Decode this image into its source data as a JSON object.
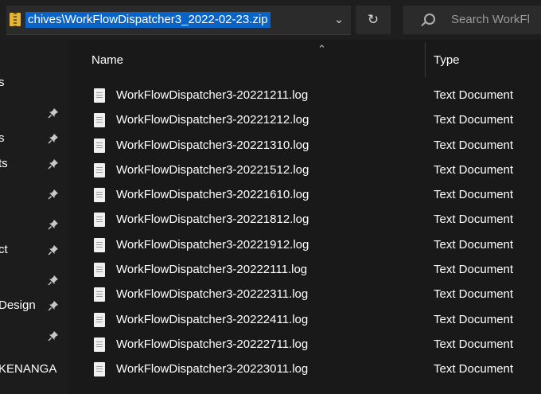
{
  "address_bar": {
    "path": "chives\\WorkFlowDispatcher3_2022-02-23.zip",
    "dropdown_icon": "chevron-down-icon",
    "refresh_icon": "refresh-icon"
  },
  "search": {
    "placeholder": "Search WorkFl"
  },
  "nav": {
    "items": [
      {
        "label": "s",
        "pinned": false
      },
      {
        "label": "",
        "pinned": true
      },
      {
        "label": "s",
        "pinned": true
      },
      {
        "label": "ts",
        "pinned": true
      },
      {
        "label": "",
        "pinned": true
      },
      {
        "label": "",
        "pinned": true
      },
      {
        "label": "ct",
        "pinned": true
      },
      {
        "label": "",
        "pinned": true
      },
      {
        "label": "Design",
        "pinned": true
      },
      {
        "label": "",
        "pinned": true
      },
      {
        "label": "KENANGA",
        "pinned": false
      }
    ]
  },
  "columns": {
    "name": "Name",
    "type": "Type"
  },
  "files": [
    {
      "name": "WorkFlowDispatcher3-20221211.log",
      "type": "Text Document"
    },
    {
      "name": "WorkFlowDispatcher3-20221212.log",
      "type": "Text Document"
    },
    {
      "name": "WorkFlowDispatcher3-20221310.log",
      "type": "Text Document"
    },
    {
      "name": "WorkFlowDispatcher3-20221512.log",
      "type": "Text Document"
    },
    {
      "name": "WorkFlowDispatcher3-20221610.log",
      "type": "Text Document"
    },
    {
      "name": "WorkFlowDispatcher3-20221812.log",
      "type": "Text Document"
    },
    {
      "name": "WorkFlowDispatcher3-20221912.log",
      "type": "Text Document"
    },
    {
      "name": "WorkFlowDispatcher3-20222111.log",
      "type": "Text Document"
    },
    {
      "name": "WorkFlowDispatcher3-20222311.log",
      "type": "Text Document"
    },
    {
      "name": "WorkFlowDispatcher3-20222411.log",
      "type": "Text Document"
    },
    {
      "name": "WorkFlowDispatcher3-20222711.log",
      "type": "Text Document"
    },
    {
      "name": "WorkFlowDispatcher3-20223011.log",
      "type": "Text Document"
    }
  ],
  "colors": {
    "background": "#191919",
    "selection": "#0a64c8",
    "text": "#ffffff"
  }
}
